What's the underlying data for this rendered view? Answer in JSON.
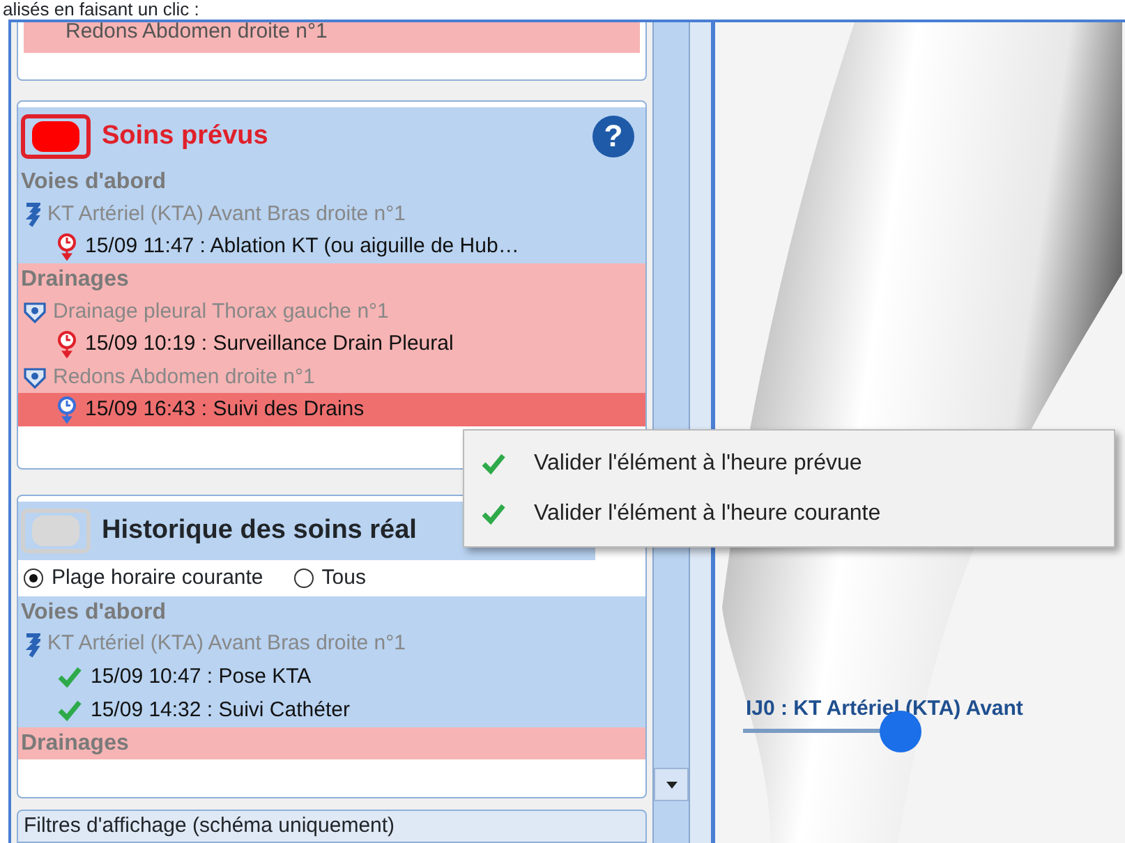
{
  "caption": "alisés en faisant un clic :",
  "previous_panel": {
    "item": "Redons Abdomen droite n°1"
  },
  "planned": {
    "title": "Soins prévus",
    "toggle_on": true,
    "help": "?",
    "groups": [
      {
        "title": "Voies d'abord",
        "color": "#b9d3f1",
        "devices": [
          {
            "name": "KT Artériel (KTA) Avant Bras droite n°1",
            "kind": "catheter",
            "tasks": [
              {
                "text": "15/09 11:47 : Ablation KT (ou aiguille de Hub…",
                "kind": "overdue",
                "selected": false
              }
            ]
          }
        ]
      },
      {
        "title": "Drainages",
        "color": "#f7b4b4",
        "devices": [
          {
            "name": "Drainage pleural Thorax gauche n°1",
            "kind": "drain",
            "tasks": [
              {
                "text": "15/09 10:19 : Surveillance Drain Pleural",
                "kind": "overdue",
                "selected": false
              }
            ]
          },
          {
            "name": "Redons Abdomen droite n°1",
            "kind": "drain",
            "tasks": [
              {
                "text": "15/09 16:43 : Suivi des Drains",
                "kind": "planned",
                "selected": true
              }
            ]
          }
        ]
      }
    ]
  },
  "history": {
    "title": "Historique des soins réal",
    "toggle_on": false,
    "filters": [
      {
        "label": "Plage horaire courante",
        "selected": true
      },
      {
        "label": "Tous",
        "selected": false
      }
    ],
    "groups": [
      {
        "title": "Voies d'abord",
        "color": "#b9d3f1",
        "devices": [
          {
            "name": "KT Artériel (KTA) Avant Bras droite n°1",
            "kind": "catheter",
            "tasks": [
              {
                "text": "15/09 10:47 : Pose KTA",
                "kind": "done",
                "selected": false
              },
              {
                "text": "15/09 14:32 : Suivi Cathéter",
                "kind": "done",
                "selected": false
              }
            ]
          }
        ]
      },
      {
        "title": "Drainages",
        "color": "#f7b4b4"
      }
    ]
  },
  "filter_bar": {
    "label": "Filtres d'affichage (schéma uniquement)"
  },
  "context_menu": [
    {
      "label": "Valider l'élément à l'heure prévue"
    },
    {
      "label": "Valider l'élément à l'heure courante"
    }
  ],
  "diagram": {
    "label": "IJ0 : KT Artériel (KTA) Avant"
  }
}
